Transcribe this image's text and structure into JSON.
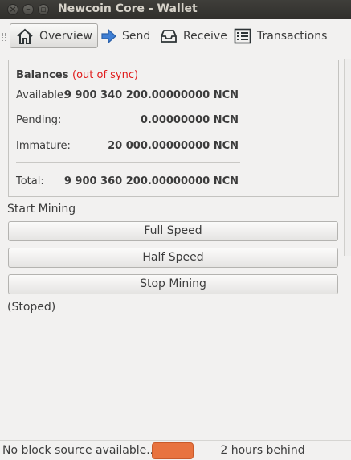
{
  "window": {
    "title": "Newcoin Core - Wallet"
  },
  "toolbar": {
    "overview": "Overview",
    "send": "Send",
    "receive": "Receive",
    "transactions": "Transactions"
  },
  "balances": {
    "heading": "Balances",
    "sync_status": "(out of sync)",
    "available_label": "Available:",
    "available_value": "9 900 340 200.00000000 NCN",
    "pending_label": "Pending:",
    "pending_value": "0.00000000 NCN",
    "immature_label": "Immature:",
    "immature_value": "20 000.00000000 NCN",
    "total_label": "Total:",
    "total_value": "9 900 360 200.00000000 NCN"
  },
  "mining": {
    "label": "Start Mining",
    "full_speed": "Full Speed",
    "half_speed": "Half Speed",
    "stop": "Stop Mining",
    "status": "(Stoped)"
  },
  "statusbar": {
    "text": "No block source available...",
    "behind": "2 hours behind",
    "progress_color": "#e8733f"
  }
}
